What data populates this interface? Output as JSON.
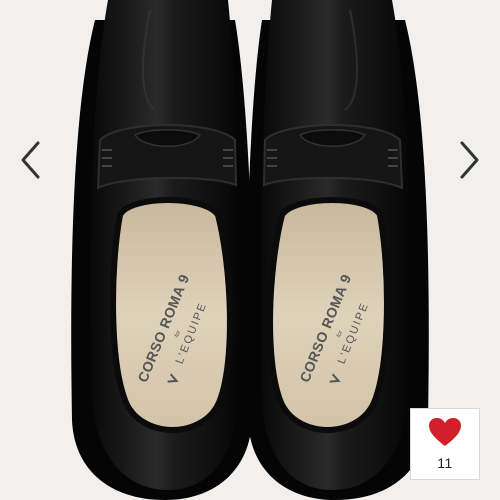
{
  "product": {
    "insole_left_line1": "CORSO ROMA 9",
    "insole_left_line2": "L'EQUIPE",
    "insole_right_line1": "CORSO ROMA 9",
    "insole_right_line2": "L'EQUIPE",
    "insole_small": "for"
  },
  "gallery": {
    "prev_icon": "chevron-left-icon",
    "next_icon": "chevron-right-icon"
  },
  "like": {
    "icon": "heart-icon",
    "count": "11",
    "color": "#d0212b"
  },
  "colors": {
    "background": "#f1f0ef",
    "shoe": "#141414",
    "insole": "#d8cbb3"
  }
}
